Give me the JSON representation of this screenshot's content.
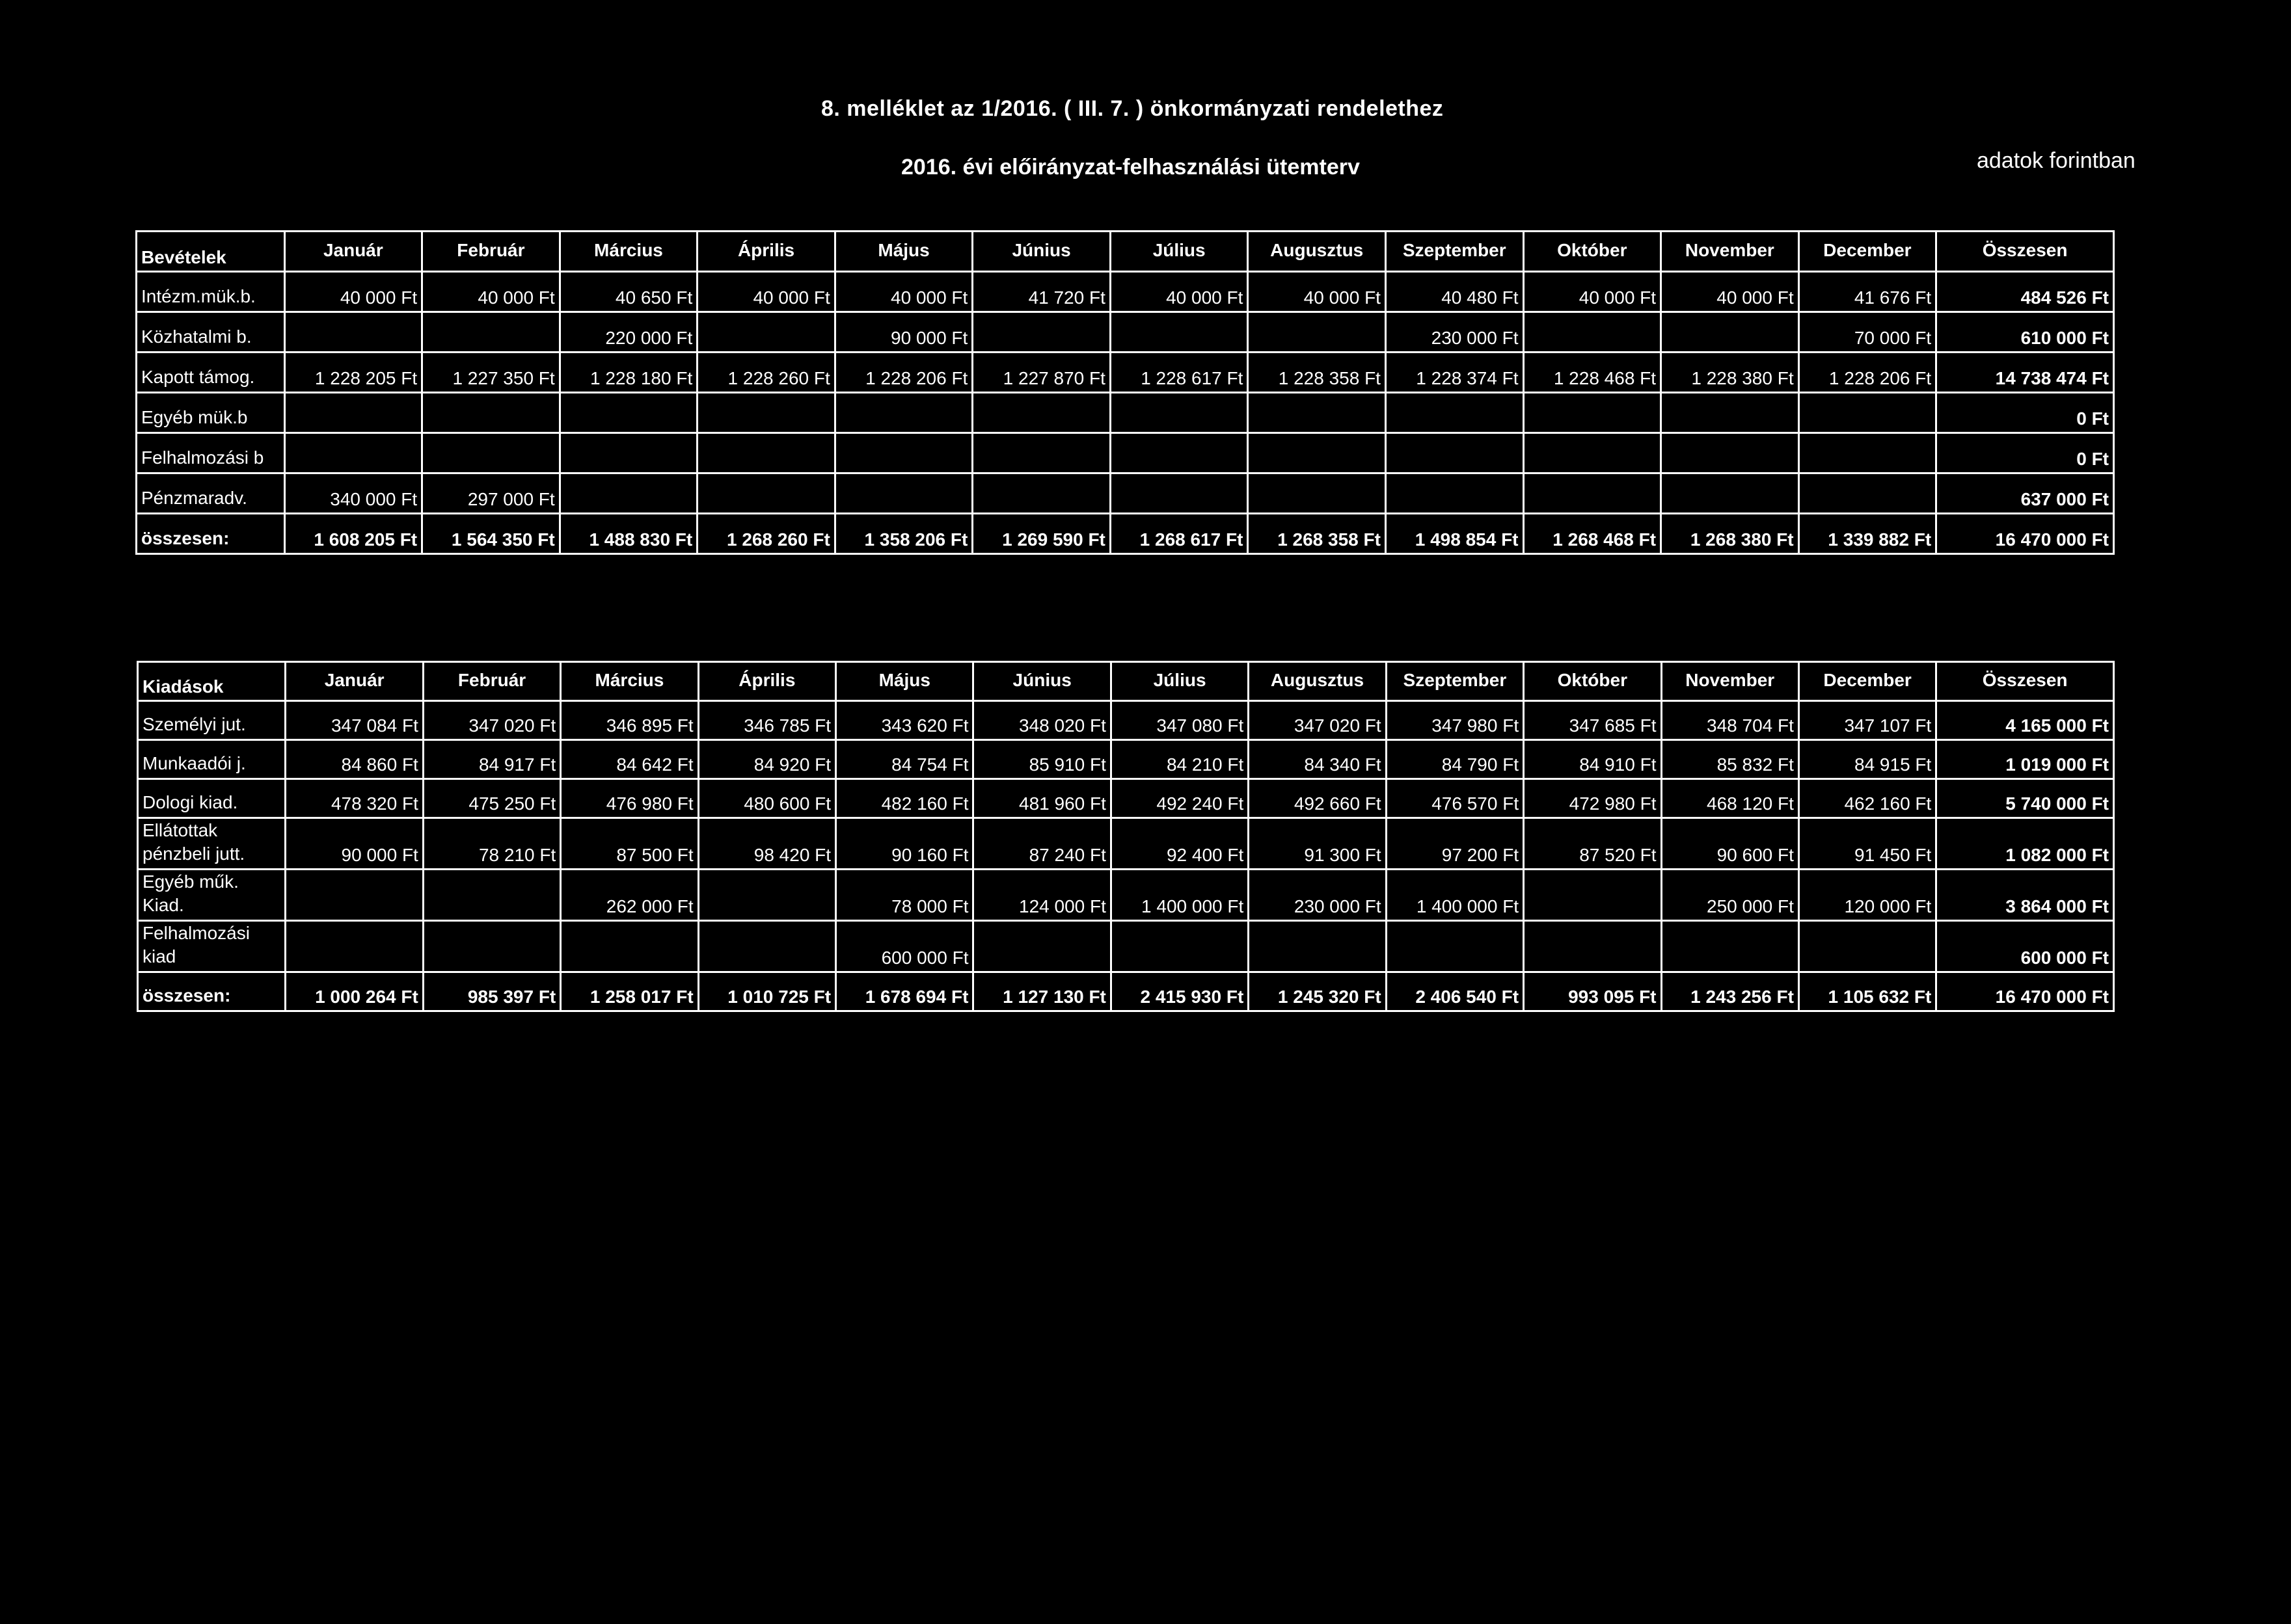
{
  "header": {
    "title": "8. melléklet az  1/2016. ( III.  7. ) önkormányzati rendelethez",
    "subtitle": "2016. évi előirányzat-felhasználási ütemterv",
    "units_note": "adatok forintban"
  },
  "months": [
    "Január",
    "Február",
    "Március",
    "Április",
    "Május",
    "Június",
    "Július",
    "Augusztus",
    "Szeptember",
    "Október",
    "November",
    "December"
  ],
  "total_header": "Összesen",
  "revenues": {
    "title": "Bevételek",
    "rows": [
      {
        "label": "Intézm.mük.b.",
        "values": [
          "40 000 Ft",
          "40 000 Ft",
          "40 650 Ft",
          "40 000 Ft",
          "40 000 Ft",
          "41 720 Ft",
          "40 000 Ft",
          "40 000 Ft",
          "40 480 Ft",
          "40 000 Ft",
          "40 000 Ft",
          "41 676 Ft"
        ],
        "total": "484 526 Ft"
      },
      {
        "label": "Közhatalmi b.",
        "values": [
          "",
          "",
          "220 000 Ft",
          "",
          "90 000 Ft",
          "",
          "",
          "",
          "230 000 Ft",
          "",
          "",
          "70 000 Ft"
        ],
        "total": "610 000 Ft"
      },
      {
        "label": "Kapott támog.",
        "values": [
          "1 228 205 Ft",
          "1 227 350 Ft",
          "1 228 180 Ft",
          "1 228 260 Ft",
          "1 228 206 Ft",
          "1 227 870 Ft",
          "1 228 617 Ft",
          "1 228 358 Ft",
          "1 228 374 Ft",
          "1 228 468 Ft",
          "1 228 380 Ft",
          "1 228 206 Ft"
        ],
        "total": "14 738 474 Ft"
      },
      {
        "label": "Egyéb mük.b",
        "values": [
          "",
          "",
          "",
          "",
          "",
          "",
          "",
          "",
          "",
          "",
          "",
          ""
        ],
        "total": "0 Ft"
      },
      {
        "label": "Felhalmozási b",
        "values": [
          "",
          "",
          "",
          "",
          "",
          "",
          "",
          "",
          "",
          "",
          "",
          ""
        ],
        "total": "0 Ft"
      },
      {
        "label": "Pénzmaradv.",
        "values": [
          "340 000 Ft",
          "297 000 Ft",
          "",
          "",
          "",
          "",
          "",
          "",
          "",
          "",
          "",
          ""
        ],
        "total": "637 000 Ft"
      }
    ],
    "sum": {
      "label": "összesen:",
      "values": [
        "1 608 205 Ft",
        "1 564 350 Ft",
        "1 488 830 Ft",
        "1 268 260 Ft",
        "1 358 206 Ft",
        "1 269 590 Ft",
        "1 268 617 Ft",
        "1 268 358 Ft",
        "1 498 854 Ft",
        "1 268 468 Ft",
        "1 268 380 Ft",
        "1 339 882 Ft"
      ],
      "total": "16 470 000 Ft"
    }
  },
  "expenses": {
    "title": "Kiadások",
    "rows": [
      {
        "label": "Személyi jut.",
        "values": [
          "347 084 Ft",
          "347 020 Ft",
          "346 895 Ft",
          "346 785 Ft",
          "343 620 Ft",
          "348 020 Ft",
          "347 080 Ft",
          "347 020 Ft",
          "347 980 Ft",
          "347 685 Ft",
          "348 704 Ft",
          "347 107 Ft"
        ],
        "total": "4 165 000 Ft"
      },
      {
        "label": "Munkaadói j.",
        "values": [
          "84 860 Ft",
          "84 917 Ft",
          "84 642 Ft",
          "84 920 Ft",
          "84 754 Ft",
          "85 910 Ft",
          "84 210 Ft",
          "84 340 Ft",
          "84 790 Ft",
          "84 910 Ft",
          "85 832 Ft",
          "84 915 Ft"
        ],
        "total": "1 019 000 Ft"
      },
      {
        "label": "Dologi kiad.",
        "values": [
          "478 320 Ft",
          "475 250 Ft",
          "476 980 Ft",
          "480 600 Ft",
          "482 160 Ft",
          "481 960 Ft",
          "492 240 Ft",
          "492 660 Ft",
          "476 570 Ft",
          "472 980 Ft",
          "468 120 Ft",
          "462 160 Ft"
        ],
        "total": "5 740 000 Ft"
      },
      {
        "label": "Ellátottak pénzbeli jutt.",
        "values": [
          "90 000 Ft",
          "78 210 Ft",
          "87 500 Ft",
          "98 420 Ft",
          "90 160 Ft",
          "87 240 Ft",
          "92 400 Ft",
          "91 300 Ft",
          "97 200 Ft",
          "87 520 Ft",
          "90 600 Ft",
          "91 450 Ft"
        ],
        "total": "1 082 000 Ft"
      },
      {
        "label": "Egyéb műk. Kiad.",
        "values": [
          "",
          "",
          "262 000 Ft",
          "",
          "78 000 Ft",
          "124 000 Ft",
          "1 400 000 Ft",
          "230 000 Ft",
          "1 400 000 Ft",
          "",
          "250 000 Ft",
          "120 000 Ft"
        ],
        "total": "3 864 000 Ft"
      },
      {
        "label": "Felhalmozási kiad",
        "values": [
          "",
          "",
          "",
          "",
          "600 000 Ft",
          "",
          "",
          "",
          "",
          "",
          "",
          ""
        ],
        "total": "600 000 Ft"
      }
    ],
    "sum": {
      "label": "összesen:",
      "values": [
        "1 000 264 Ft",
        "985 397 Ft",
        "1 258 017 Ft",
        "1 010 725 Ft",
        "1 678 694 Ft",
        "1 127 130 Ft",
        "2 415 930 Ft",
        "1 245 320 Ft",
        "2 406 540 Ft",
        "993 095 Ft",
        "1 243 256 Ft",
        "1 105 632 Ft"
      ],
      "total": "16 470 000 Ft"
    }
  }
}
